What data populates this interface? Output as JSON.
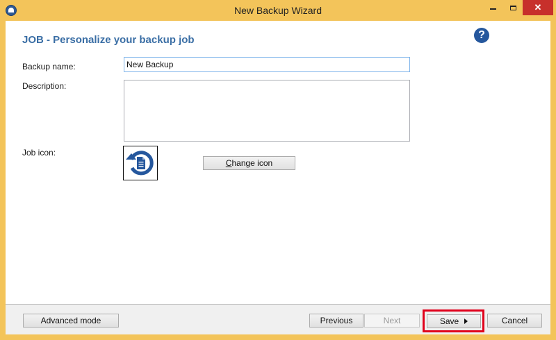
{
  "window": {
    "title": "New Backup Wizard",
    "close_glyph": "✕"
  },
  "page": {
    "heading": "JOB - Personalize your backup job",
    "help_glyph": "?"
  },
  "form": {
    "name_label": "Backup name:",
    "name_value": "New Backup",
    "description_label": "Description:",
    "description_value": "",
    "icon_label": "Job icon:",
    "change_icon_first": "C",
    "change_icon_rest": "hange icon"
  },
  "footer": {
    "advanced_mode": "Advanced mode",
    "previous": "Previous",
    "next": "Next",
    "save": "Save",
    "cancel": "Cancel"
  },
  "colors": {
    "frame": "#f3c45a",
    "heading": "#3a6ea5",
    "icon_blue": "#25579d",
    "highlight": "#e0001b",
    "close": "#c7302b"
  },
  "icons": {
    "app": "backup-app-icon",
    "help": "help-icon",
    "job": "backup-restore-document-icon",
    "save_arrow": "play-arrow-icon"
  }
}
